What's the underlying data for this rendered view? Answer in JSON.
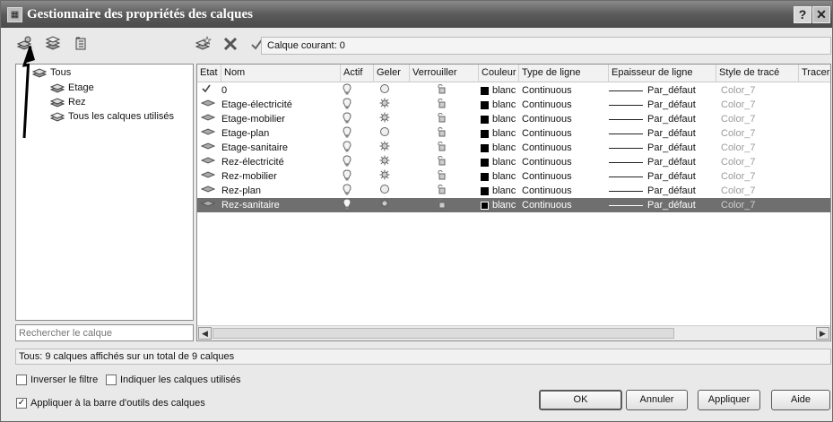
{
  "window": {
    "title": "Gestionnaire des propriétés des calques",
    "help": "?",
    "close": "✕"
  },
  "toolbar": {
    "current_layer_label": "Calque courant: 0"
  },
  "filter_tree": {
    "root": "Tous",
    "children": [
      "Etage",
      "Rez",
      "Tous les calques utilisés"
    ]
  },
  "search": {
    "placeholder": "Rechercher le calque"
  },
  "columns": {
    "status": "Etat",
    "name": "Nom",
    "on": "Actif",
    "freeze": "Geler",
    "lock": "Verrouiller",
    "color": "Couleur",
    "linetype": "Type de ligne",
    "lineweight": "Epaisseur de ligne",
    "plotstyle": "Style de tracé",
    "plot": "Tracer"
  },
  "layers": [
    {
      "name": "0",
      "on": true,
      "frozen": false,
      "color": "blanc",
      "linetype": "Continuous",
      "lineweight": "Par_défaut",
      "plotstyle": "Color_7",
      "current": true,
      "selected": false
    },
    {
      "name": "Etage-électricité",
      "on": true,
      "frozen": true,
      "color": "blanc",
      "linetype": "Continuous",
      "lineweight": "Par_défaut",
      "plotstyle": "Color_7",
      "current": false,
      "selected": false
    },
    {
      "name": "Etage-mobilier",
      "on": true,
      "frozen": true,
      "color": "blanc",
      "linetype": "Continuous",
      "lineweight": "Par_défaut",
      "plotstyle": "Color_7",
      "current": false,
      "selected": false
    },
    {
      "name": "Etage-plan",
      "on": true,
      "frozen": false,
      "color": "blanc",
      "linetype": "Continuous",
      "lineweight": "Par_défaut",
      "plotstyle": "Color_7",
      "current": false,
      "selected": false
    },
    {
      "name": "Etage-sanitaire",
      "on": true,
      "frozen": true,
      "color": "blanc",
      "linetype": "Continuous",
      "lineweight": "Par_défaut",
      "plotstyle": "Color_7",
      "current": false,
      "selected": false
    },
    {
      "name": "Rez-électricité",
      "on": true,
      "frozen": true,
      "color": "blanc",
      "linetype": "Continuous",
      "lineweight": "Par_défaut",
      "plotstyle": "Color_7",
      "current": false,
      "selected": false
    },
    {
      "name": "Rez-mobilier",
      "on": true,
      "frozen": true,
      "color": "blanc",
      "linetype": "Continuous",
      "lineweight": "Par_défaut",
      "plotstyle": "Color_7",
      "current": false,
      "selected": false
    },
    {
      "name": "Rez-plan",
      "on": true,
      "frozen": false,
      "color": "blanc",
      "linetype": "Continuous",
      "lineweight": "Par_défaut",
      "plotstyle": "Color_7",
      "current": false,
      "selected": false
    },
    {
      "name": "Rez-sanitaire",
      "on": true,
      "frozen": true,
      "color": "blanc",
      "linetype": "Continuous",
      "lineweight": "Par_défaut",
      "plotstyle": "Color_7",
      "current": false,
      "selected": true
    }
  ],
  "status": {
    "text": "Tous: 9 calques affichés sur un total de 9 calques"
  },
  "options": {
    "invert_filter": {
      "label": "Inverser le filtre",
      "checked": false
    },
    "show_used": {
      "label": "Indiquer les calques utilisés",
      "checked": false
    },
    "apply_toolbar": {
      "label": "Appliquer à la barre d'outils des calques",
      "checked": true
    }
  },
  "buttons": {
    "ok": "OK",
    "cancel": "Annuler",
    "apply": "Appliquer",
    "help": "Aide"
  }
}
